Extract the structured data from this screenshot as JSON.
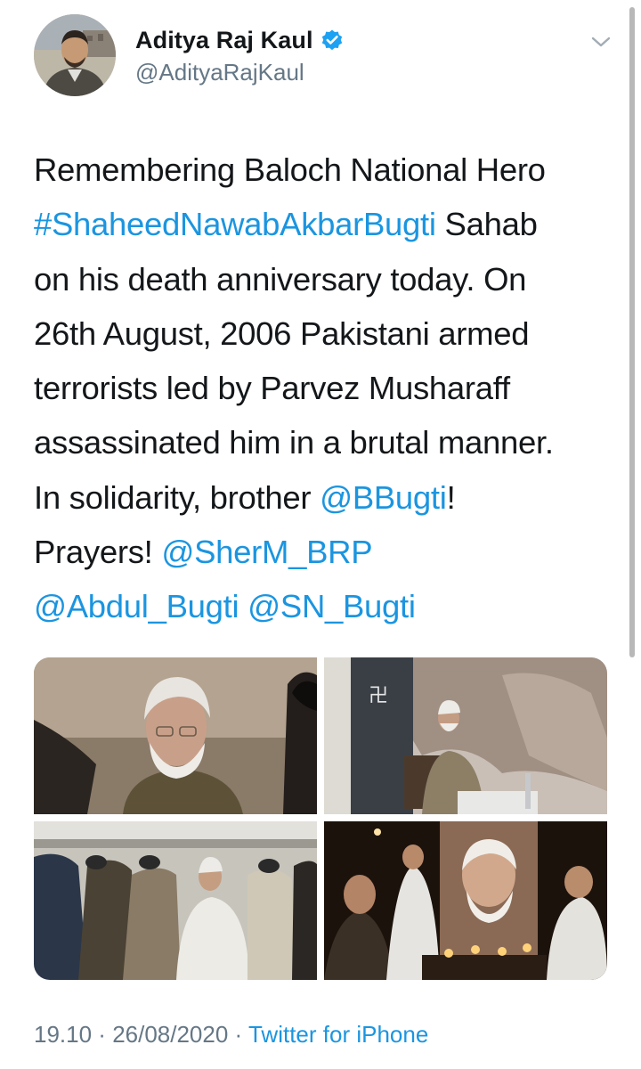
{
  "author": {
    "display_name": "Aditya Raj Kaul",
    "handle": "@AdityaRajKaul",
    "verified": true
  },
  "tweet": {
    "lines": [
      [
        {
          "text": "Remembering Baloch National Hero",
          "type": "text"
        }
      ],
      [
        {
          "text": "#ShaheedNawabAkbarBugti",
          "type": "hashtag"
        },
        {
          "text": " Sahab",
          "type": "text"
        }
      ],
      [
        {
          "text": "on his death anniversary today. On",
          "type": "text"
        }
      ],
      [
        {
          "text": "26th August, 2006 Pakistani armed",
          "type": "text"
        }
      ],
      [
        {
          "text": "terrorists led by Parvez Musharaff",
          "type": "text"
        }
      ],
      [
        {
          "text": "assassinated him in a brutal manner.",
          "type": "text"
        }
      ],
      [
        {
          "text": "In solidarity, brother ",
          "type": "text"
        },
        {
          "text": "@BBugti",
          "type": "mention"
        },
        {
          "text": "!",
          "type": "text"
        }
      ],
      [
        {
          "text": "Prayers! ",
          "type": "text"
        },
        {
          "text": "@SherM_BRP",
          "type": "mention"
        }
      ],
      [
        {
          "text": "@Abdul_Bugti",
          "type": "mention"
        },
        {
          "text": " ",
          "type": "text"
        },
        {
          "text": "@SN_Bugti",
          "type": "mention"
        }
      ]
    ]
  },
  "media": {
    "count": 4
  },
  "footer": {
    "time": "19.10",
    "separator": " · ",
    "date": "26/08/2020",
    "source": "Twitter for iPhone"
  },
  "colors": {
    "link": "#1b95e0",
    "text": "#14171a",
    "muted": "#657786",
    "verified": "#1da1f2"
  },
  "icons": {
    "verified": "verified-badge-icon",
    "caret": "chevron-down-icon"
  }
}
